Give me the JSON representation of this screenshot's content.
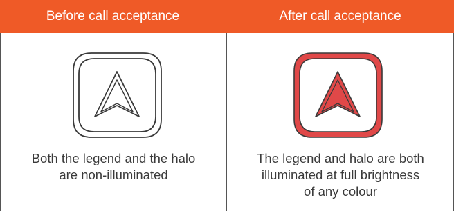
{
  "header": {
    "before_label": "Before call acceptance",
    "after_label": "After call acceptance",
    "header_color": "#ef5a27"
  },
  "panels": [
    {
      "state": "before",
      "icon": "arrow-button-icon",
      "illuminated": false,
      "caption_line1": "Both the legend and the halo",
      "caption_line2": "are non-illuminated"
    },
    {
      "state": "after",
      "icon": "arrow-button-icon",
      "illuminated": true,
      "illumination_color": "#e04848",
      "caption_line1": "The legend and halo are both",
      "caption_line2": "illuminated at full brightness",
      "caption_line3": "of any colour"
    }
  ]
}
